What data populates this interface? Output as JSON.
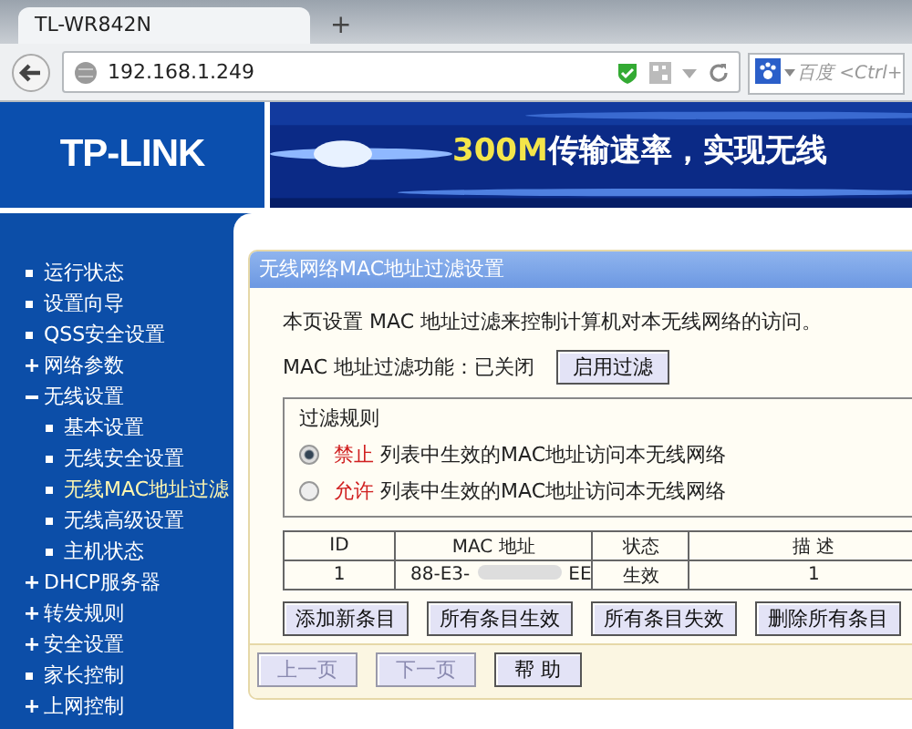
{
  "browser": {
    "tab_title": "TL-WR842N",
    "new_tab": "+",
    "url": "192.168.1.249",
    "search_placeholder": "百度 <Ctrl+"
  },
  "banner": {
    "logo": "TP-LINK",
    "slogan_highlight": "300M",
    "slogan": "传输速率，实现无线"
  },
  "sidebar": {
    "items": [
      {
        "label": "运行状态",
        "kind": "link",
        "selected": false
      },
      {
        "label": "设置向导",
        "kind": "link",
        "selected": false
      },
      {
        "label": "QSS安全设置",
        "kind": "link",
        "selected": false
      },
      {
        "label": "网络参数",
        "kind": "collapsed",
        "selected": false
      },
      {
        "label": "无线设置",
        "kind": "expanded",
        "selected": false,
        "children": [
          {
            "label": "基本设置",
            "kind": "link",
            "selected": false
          },
          {
            "label": "无线安全设置",
            "kind": "link",
            "selected": false
          },
          {
            "label": "无线MAC地址过滤",
            "kind": "link",
            "selected": true
          },
          {
            "label": "无线高级设置",
            "kind": "link",
            "selected": false
          },
          {
            "label": "主机状态",
            "kind": "link",
            "selected": false
          }
        ]
      },
      {
        "label": "DHCP服务器",
        "kind": "collapsed",
        "selected": false
      },
      {
        "label": "转发规则",
        "kind": "collapsed",
        "selected": false
      },
      {
        "label": "安全设置",
        "kind": "collapsed",
        "selected": false
      },
      {
        "label": "家长控制",
        "kind": "link",
        "selected": false
      },
      {
        "label": "上网控制",
        "kind": "collapsed",
        "selected": false
      }
    ]
  },
  "panel": {
    "title": "无线网络MAC地址过滤设置",
    "description": "本页设置 MAC 地址过滤来控制计算机对本无线网络的访问。",
    "status_label": "MAC 地址过滤功能：已关闭",
    "toggle_button": "启用过滤",
    "rules": {
      "title": "过滤规则",
      "options": [
        {
          "action": "禁止",
          "text": "列表中生效的MAC地址访问本无线网络",
          "selected": true
        },
        {
          "action": "允许",
          "text": "列表中生效的MAC地址访问本无线网络",
          "selected": false
        }
      ]
    },
    "table": {
      "columns": [
        "ID",
        "MAC 地址",
        "状态",
        "描 述"
      ],
      "rows": [
        {
          "id": "1",
          "mac_start": "88-E3-",
          "mac_end": "EE",
          "status": "生效",
          "description": "1"
        }
      ]
    },
    "actions": [
      "添加新条目",
      "所有条目生效",
      "所有条目失效",
      "删除所有条目"
    ],
    "nav": [
      {
        "label": "上一页",
        "disabled": true
      },
      {
        "label": "下一页",
        "disabled": true
      },
      {
        "label": "帮 助",
        "disabled": false
      }
    ]
  }
}
